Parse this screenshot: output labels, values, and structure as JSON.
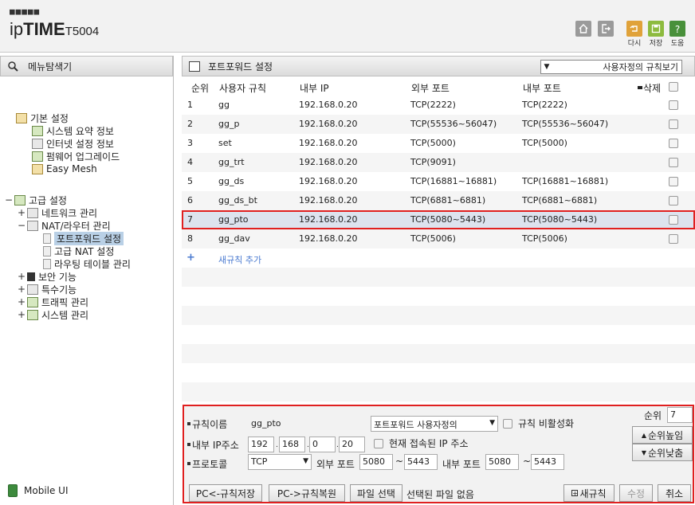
{
  "header": {
    "logo_dots": "■■■■■",
    "brand_ip": "ip",
    "brand_time": "TIME",
    "model": "T5004",
    "buttons": {
      "home_icon": "home-icon",
      "logout_icon": "logout-icon",
      "restart_label": "다시",
      "save_label": "저장",
      "help_label": "도움"
    }
  },
  "sidebar": {
    "title": "메뉴탐색기",
    "basic": {
      "label": "기본 설정",
      "items": [
        "시스템 요약 정보",
        "인터넷 설정 정보",
        "펌웨어 업그레이드",
        "Easy Mesh"
      ]
    },
    "advanced": {
      "label": "고급 설정",
      "network": "네트워크 관리",
      "nat": "NAT/라우터 관리",
      "nat_items": [
        "포트포워드 설정",
        "고급 NAT 설정",
        "라우팅 테이블 관리"
      ],
      "security": "보안 기능",
      "special": "특수기능",
      "traffic": "트래픽 관리",
      "system": "시스템 관리"
    },
    "mobile": "Mobile UI"
  },
  "main": {
    "title": "포트포워드 설정",
    "view_select": "사용자정의 규칙보기",
    "columns": {
      "order": "순위",
      "name": "사용자 규칙",
      "internal_ip": "내부 IP",
      "external_port": "외부 포트",
      "internal_port": "내부 포트",
      "delete": "삭제"
    },
    "rows": [
      {
        "order": "1",
        "name": "gg",
        "ip": "192.168.0.20",
        "ext": "TCP(2222)",
        "int": "TCP(2222)"
      },
      {
        "order": "2",
        "name": "gg_p",
        "ip": "192.168.0.20",
        "ext": "TCP(55536~56047)",
        "int": "TCP(55536~56047)"
      },
      {
        "order": "3",
        "name": "set",
        "ip": "192.168.0.20",
        "ext": "TCP(5000)",
        "int": "TCP(5000)"
      },
      {
        "order": "4",
        "name": "gg_trt",
        "ip": "192.168.0.20",
        "ext": "TCP(9091)",
        "int": ""
      },
      {
        "order": "5",
        "name": "gg_ds",
        "ip": "192.168.0.20",
        "ext": "TCP(16881~16881)",
        "int": "TCP(16881~16881)"
      },
      {
        "order": "6",
        "name": "gg_ds_bt",
        "ip": "192.168.0.20",
        "ext": "TCP(6881~6881)",
        "int": "TCP(6881~6881)"
      },
      {
        "order": "7",
        "name": "gg_pto",
        "ip": "192.168.0.20",
        "ext": "TCP(5080~5443)",
        "int": "TCP(5080~5443)"
      },
      {
        "order": "8",
        "name": "gg_dav",
        "ip": "192.168.0.20",
        "ext": "TCP(5006)",
        "int": "TCP(5006)"
      }
    ],
    "add_rule": "새규칙 추가"
  },
  "form": {
    "rule_name_label": "규칙이름",
    "rule_name_value": "gg_pto",
    "rule_type": "포트포워드 사용자정의",
    "disable_label": "규칙 비활성화",
    "order_label": "순위",
    "order_value": "7",
    "ip_label": "내부 IP주소",
    "ip": [
      "192",
      "168",
      "0",
      "20"
    ],
    "current_ip_label": "현재 접속된 IP 주소",
    "up_button": "순위높임",
    "down_button": "순위낮춤",
    "protocol_label": "프로토콜",
    "protocol_value": "TCP",
    "ext_port_label": "외부 포트",
    "ext_port_from": "5080",
    "ext_port_to": "5443",
    "int_port_label": "내부 포트",
    "int_port_from": "5080",
    "int_port_to": "5443",
    "tilde": "~",
    "backup_button": "PC<-규칙저장",
    "restore_button": "PC->규칙복원",
    "file_button": "파일 선택",
    "file_status": "선택된 파일 없음",
    "new_button": "새규칙",
    "modify_button": "수정",
    "cancel_button": "취소"
  }
}
